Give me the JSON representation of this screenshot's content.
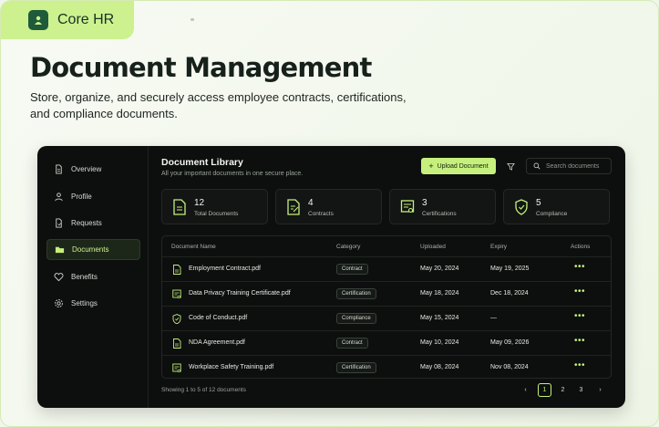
{
  "brand": {
    "name": "Core HR"
  },
  "hero": {
    "title": "Document Management",
    "description": "Store, organize, and securely access employee contracts, certifications, and compliance documents."
  },
  "sidebar": {
    "items": [
      {
        "label": "Overview",
        "icon": "file-icon",
        "active": false
      },
      {
        "label": "Profile",
        "icon": "user-icon",
        "active": false
      },
      {
        "label": "Requests",
        "icon": "request-icon",
        "active": false
      },
      {
        "label": "Documents",
        "icon": "folder-icon",
        "active": true
      },
      {
        "label": "Benefits",
        "icon": "heart-icon",
        "active": false
      },
      {
        "label": "Settings",
        "icon": "gear-icon",
        "active": false
      }
    ]
  },
  "library": {
    "title": "Document Library",
    "subtitle": "All your important documents in one secure place.",
    "upload_label": "Upload Document",
    "search_placeholder": "Search documents"
  },
  "stats": [
    {
      "value": "12",
      "label": "Total Documents",
      "icon": "document-icon"
    },
    {
      "value": "4",
      "label": "Contracts",
      "icon": "contract-icon"
    },
    {
      "value": "3",
      "label": "Certifications",
      "icon": "certificate-icon"
    },
    {
      "value": "5",
      "label": "Compliance",
      "icon": "shield-icon"
    }
  ],
  "table": {
    "headers": [
      "Document Name",
      "Category",
      "Uploaded",
      "Expiry",
      "Actions"
    ],
    "rows": [
      {
        "name": "Employment Contract.pdf",
        "category": "Contract",
        "uploaded": "May 20, 2024",
        "expiry": "May 19, 2025",
        "icon": "document-icon"
      },
      {
        "name": "Data Privacy Training Certificate.pdf",
        "category": "Certification",
        "uploaded": "May 18, 2024",
        "expiry": "Dec 18, 2024",
        "icon": "certificate-icon"
      },
      {
        "name": "Code of Conduct.pdf",
        "category": "Compliance",
        "uploaded": "May 15, 2024",
        "expiry": "—",
        "icon": "shield-icon"
      },
      {
        "name": "NDA Agreement.pdf",
        "category": "Contract",
        "uploaded": "May 10, 2024",
        "expiry": "May 09, 2026",
        "icon": "document-icon"
      },
      {
        "name": "Workplace Safety Training.pdf",
        "category": "Certification",
        "uploaded": "May 08, 2024",
        "expiry": "Nov 08, 2024",
        "icon": "certificate-icon"
      }
    ],
    "actions_label": "•••"
  },
  "pagination": {
    "summary": "Showing 1 to 5 of 12 documents",
    "prev": "‹",
    "next": "›",
    "pages": [
      "1",
      "2",
      "3"
    ],
    "current": "1"
  },
  "colors": {
    "accent": "#c6f07d",
    "brand_bg": "#cdf18e",
    "panel_bg": "#0d0f0e"
  }
}
